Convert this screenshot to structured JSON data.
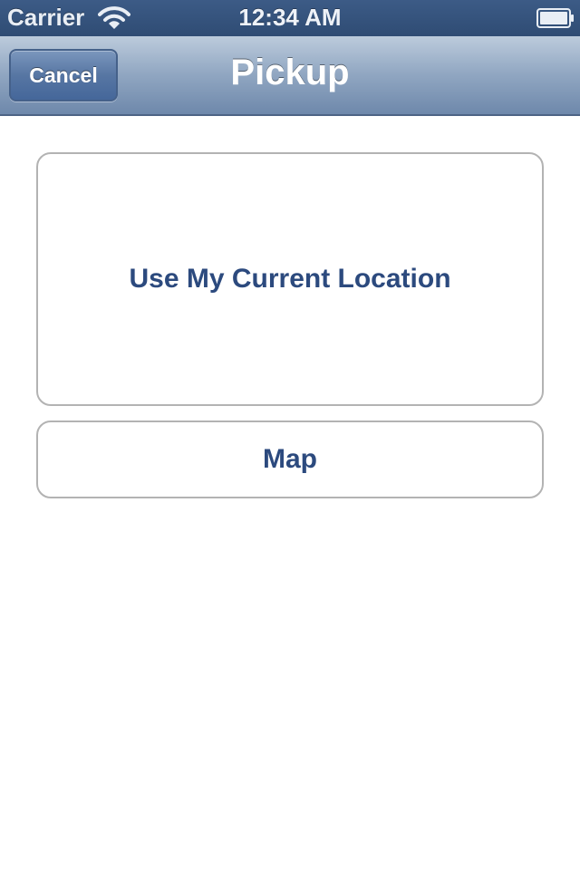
{
  "status_bar": {
    "carrier": "Carrier",
    "time": "12:34 AM",
    "wifi_icon": "wifi-icon",
    "battery_icon": "battery-icon"
  },
  "nav_bar": {
    "title": "Pickup",
    "cancel_label": "Cancel"
  },
  "options": {
    "current_location_label": "Use My Current Location",
    "map_label": "Map"
  },
  "colors": {
    "status_bar_bg": "#2f4c74",
    "nav_bar_bg": "#91a7c2",
    "button_text": "#2c4a7e",
    "button_border": "#b3b3b3"
  }
}
